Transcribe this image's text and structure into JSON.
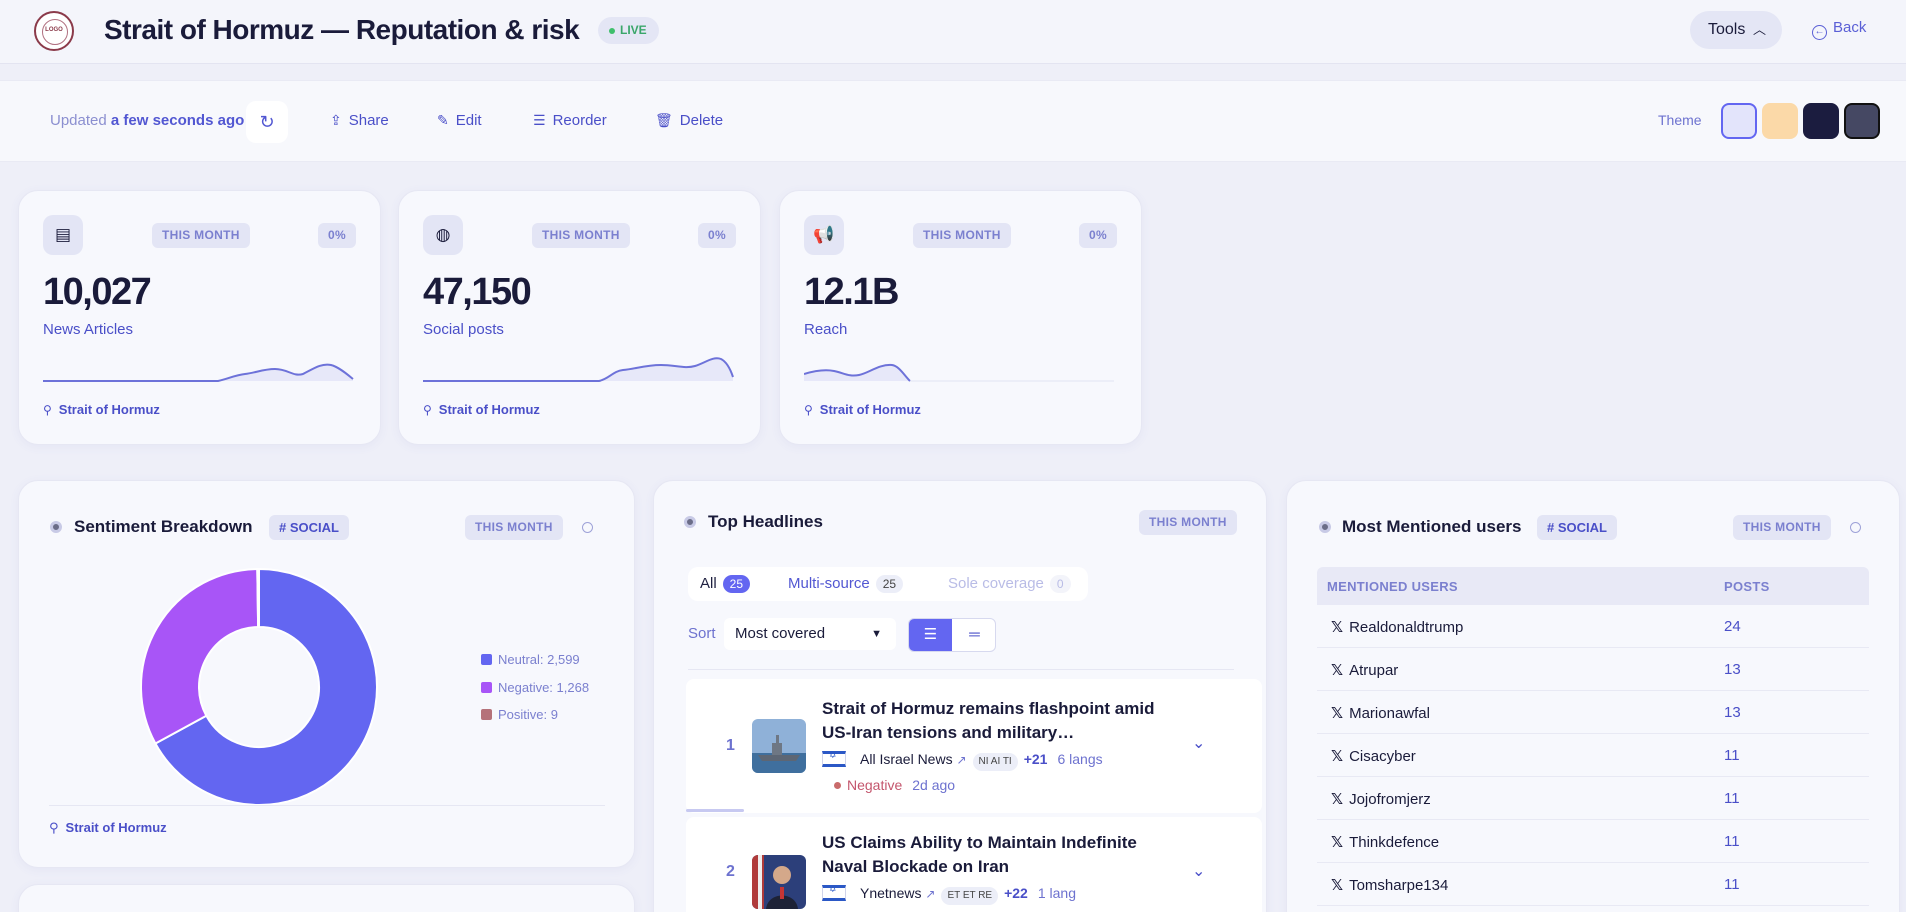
{
  "header": {
    "logo_text": "LOGO",
    "title": "Strait of Hormuz — Reputation & risk",
    "live_label": "LIVE",
    "tools_label": "Tools",
    "back_label": "Back"
  },
  "toolbar": {
    "updated_prefix": "Updated",
    "updated_value": "a few seconds ago",
    "share_label": "Share",
    "edit_label": "Edit",
    "reorder_label": "Reorder",
    "delete_label": "Delete",
    "theme_label": "Theme",
    "theme_swatches": [
      "#e3e4fb",
      "#fbd9a8",
      "#1b1c3f",
      "#454863"
    ]
  },
  "stats": [
    {
      "icon": "newspaper-icon",
      "period": "THIS MONTH",
      "change": "0%",
      "value": "10,027",
      "label": "News Articles",
      "query": "Strait of Hormuz"
    },
    {
      "icon": "globe-icon",
      "period": "THIS MONTH",
      "change": "0%",
      "value": "47,150",
      "label": "Social posts",
      "query": "Strait of Hormuz"
    },
    {
      "icon": "megaphone-icon",
      "period": "THIS MONTH",
      "change": "0%",
      "value": "12.1B",
      "label": "Reach",
      "query": "Strait of Hormuz"
    }
  ],
  "sentiment": {
    "title": "Sentiment Breakdown",
    "tag": "SOCIAL",
    "period": "THIS MONTH",
    "query": "Strait of Hormuz",
    "legend": [
      "Neutral: 2,599",
      "Negative: 1,268",
      "Positive: 9"
    ],
    "colors": {
      "neutral": "#6366f1",
      "negative": "#a855f7",
      "positive": "#b5727a"
    }
  },
  "chart_data": {
    "type": "pie",
    "categories": [
      "Neutral",
      "Negative",
      "Positive"
    ],
    "values": [
      2599,
      1268,
      9
    ],
    "title": "Sentiment Breakdown"
  },
  "headlines": {
    "title": "Top Headlines",
    "period": "THIS MONTH",
    "tabs": [
      {
        "label": "All",
        "count": "25"
      },
      {
        "label": "Multi-source",
        "count": "25"
      },
      {
        "label": "Sole coverage",
        "count": "0"
      }
    ],
    "sort_label": "Sort",
    "sort_value": "Most covered",
    "items": [
      {
        "rank": "1",
        "title": "Strait of Hormuz remains flashpoint amid US-Iran tensions and military…",
        "source": "All Israel News",
        "logos": "NI AI TI",
        "more": "+21",
        "langs": "6 langs",
        "sentiment": "Negative",
        "ago": "2d ago"
      },
      {
        "rank": "2",
        "title": "US Claims Ability to Maintain Indefinite Naval Blockade on Iran",
        "source": "Ynetnews",
        "logos": "ET ET RE",
        "more": "+22",
        "langs": "1 lang"
      }
    ]
  },
  "users": {
    "title": "Most Mentioned users",
    "tag": "SOCIAL",
    "period": "THIS MONTH",
    "col_user": "MENTIONED USERS",
    "col_posts": "POSTS",
    "rows": [
      {
        "name": "Realdonaldtrump",
        "posts": "24"
      },
      {
        "name": "Atrupar",
        "posts": "13"
      },
      {
        "name": "Marionawfal",
        "posts": "13"
      },
      {
        "name": "Cisacyber",
        "posts": "11"
      },
      {
        "name": "Jojofromjerz",
        "posts": "11"
      },
      {
        "name": "Thinkdefence",
        "posts": "11"
      },
      {
        "name": "Tomsharpe134",
        "posts": "11"
      }
    ]
  }
}
